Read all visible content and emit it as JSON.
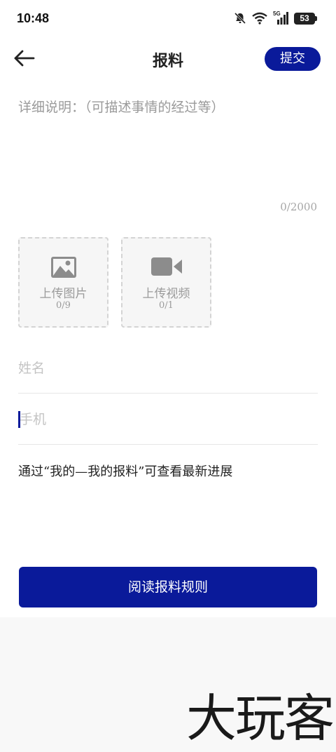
{
  "status": {
    "time": "10:48",
    "network": "5G",
    "battery": "53"
  },
  "header": {
    "title": "报料",
    "submit_label": "提交"
  },
  "description": {
    "placeholder": "详细说明：（可描述事情的经过等）",
    "counter": "0/2000"
  },
  "uploads": [
    {
      "label": "上传图片",
      "count": "0/9",
      "icon": "image-icon"
    },
    {
      "label": "上传视频",
      "count": "0/1",
      "icon": "video-camera-icon"
    }
  ],
  "form": {
    "name_placeholder": "姓名",
    "phone_placeholder": "手机"
  },
  "hint": "通过“我的—我的报料”可查看最新进展",
  "rules_button": "阅读报料规则",
  "watermark": "大玩客",
  "colors": {
    "accent": "#0a1a9a",
    "placeholder": "#9a9a9a"
  }
}
